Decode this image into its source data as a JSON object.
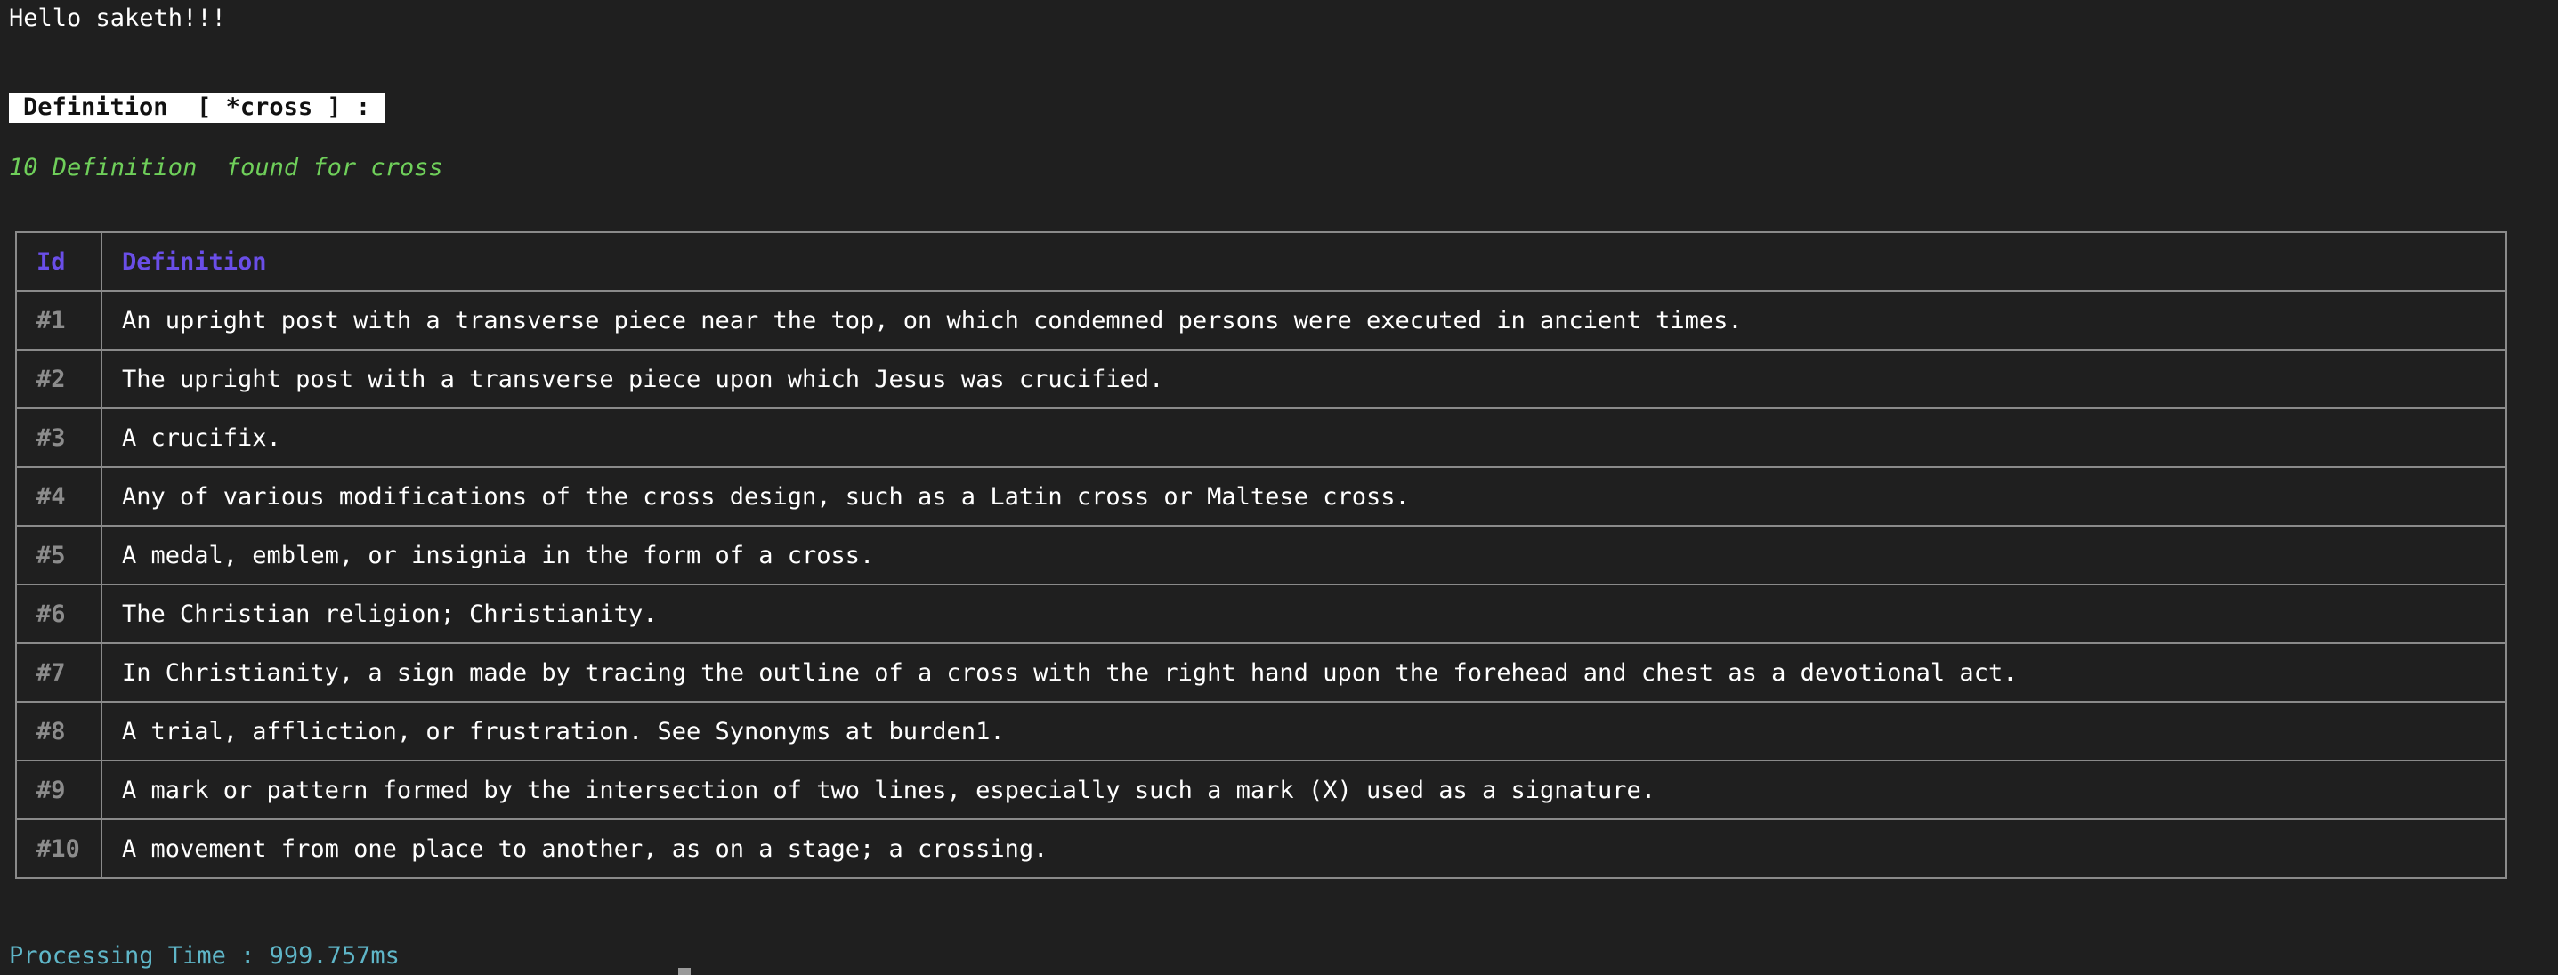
{
  "greeting": "Hello saketh!!!",
  "header_badge": "Definition  [ *cross ] :",
  "found_line": "10 Definition  found for cross",
  "table": {
    "headers": {
      "id": "Id",
      "definition": "Definition"
    },
    "rows": [
      {
        "id": "#1",
        "definition": "An upright post with a transverse piece near the top, on which condemned persons were executed in ancient times."
      },
      {
        "id": "#2",
        "definition": "The upright post with a transverse piece upon which Jesus was crucified."
      },
      {
        "id": "#3",
        "definition": "A crucifix."
      },
      {
        "id": "#4",
        "definition": "Any of various modifications of the cross design, such as a Latin cross or Maltese cross."
      },
      {
        "id": "#5",
        "definition": "A medal, emblem, or insignia in the form of a cross."
      },
      {
        "id": "#6",
        "definition": "The Christian religion; Christianity."
      },
      {
        "id": "#7",
        "definition": "In Christianity, a sign made by tracing the outline of a cross with the right hand upon the forehead and chest as a devotional act."
      },
      {
        "id": "#8",
        "definition": "A trial, affliction, or frustration. See Synonyms at burden1."
      },
      {
        "id": "#9",
        "definition": "A mark or pattern formed by the intersection of two lines, especially such a mark (X) used as a signature."
      },
      {
        "id": "#10",
        "definition": "A movement from one place to another, as on a stage; a crossing."
      }
    ]
  },
  "processing_time": "Processing Time : 999.757ms",
  "colors": {
    "background": "#1f1f1f",
    "found_green": "#6fcf5a",
    "header_purple": "#6a4ee8",
    "id_gray": "#8c8c8c",
    "time_cyan": "#5fb6c8"
  }
}
